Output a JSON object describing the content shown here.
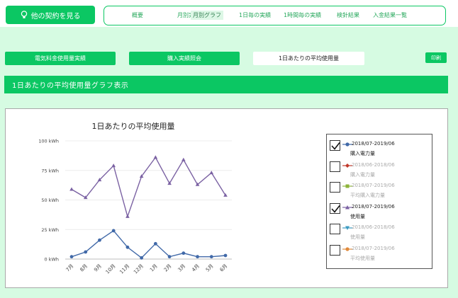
{
  "header": {
    "contract_button": "他の契約を見る",
    "nav": [
      "概要",
      "月別実績",
      "月別グラフ",
      "1日毎の実績",
      "1時間毎の実績",
      "検針結果",
      "入金結果一覧"
    ],
    "nav_active_index": 2
  },
  "subtabs": {
    "electricity_fee": "電気料金使用量実績",
    "purchase": "購入実績照会",
    "daily_average": "1日あたりの平均使用量",
    "print": "印刷"
  },
  "section_title": "1日あたりの平均使用量グラフ表示",
  "colors": {
    "accent": "#0bc763",
    "blue": "#4169a8",
    "purple": "#7b62a3",
    "red": "#c0392b",
    "olive": "#8db43a",
    "teal": "#3d9bc1",
    "orange": "#e08a3c"
  },
  "chart_data": {
    "type": "line",
    "title": "1日あたりの平均使用量",
    "categories": [
      "7月",
      "8月",
      "9月",
      "10月",
      "11月",
      "12月",
      "1月",
      "2月",
      "3月",
      "4月",
      "5月",
      "6月"
    ],
    "yticks": [
      "0 kWh",
      "25 kWh",
      "50 kWh",
      "75 kWh",
      "100 kWh"
    ],
    "ylim": [
      0,
      100
    ],
    "grid": true,
    "legend_position": "right",
    "series": [
      {
        "period": "2018/07-2019/06",
        "name": "購入電力量",
        "marker": "circle",
        "color": "#4169a8",
        "values": [
          2,
          6,
          16,
          24,
          10,
          1,
          13,
          2,
          5,
          2,
          2,
          3
        ]
      },
      {
        "period": "2018/07-2019/06",
        "name": "使用量",
        "marker": "triangle",
        "color": "#7b62a3",
        "values": [
          59,
          52,
          67,
          79,
          36,
          70,
          86,
          64,
          84,
          63,
          73,
          54
        ]
      }
    ]
  },
  "legend": [
    {
      "period": "2018/07-2019/06",
      "name": "購入電力量",
      "checked": true,
      "marker": "circle",
      "color": "#4169a8"
    },
    {
      "period": "2018/06-2018/06",
      "name": "購入電力量",
      "checked": false,
      "marker": "diamond",
      "color": "#c0392b"
    },
    {
      "period": "2018/07-2019/06",
      "name": "平均購入電力量",
      "checked": false,
      "marker": "square",
      "color": "#8db43a"
    },
    {
      "period": "2018/07-2019/06",
      "name": "使用量",
      "checked": true,
      "marker": "triangle",
      "color": "#7b62a3"
    },
    {
      "period": "2018/06-2018/06",
      "name": "使用量",
      "checked": false,
      "marker": "triangle-down",
      "color": "#3d9bc1"
    },
    {
      "period": "2018/07-2019/06",
      "name": "平均使用量",
      "checked": false,
      "marker": "circle",
      "color": "#e08a3c"
    }
  ]
}
